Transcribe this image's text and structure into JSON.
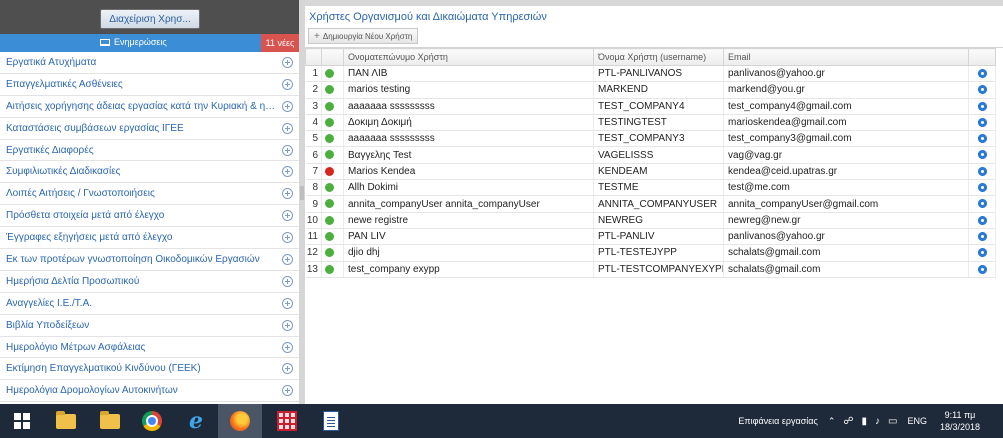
{
  "left": {
    "manage_button": "Διαχείριση Χρησ...",
    "notifications_label": "Ενημερώσεις",
    "notifications_count": "11 νέες",
    "menu": [
      "Εργατικά Ατυχήματα",
      "Επαγγελματικές Ασθένειες",
      "Αιτήσεις χορήγησης άδειας εργασίας κατά την Κυριακή & ημέ...",
      "Καταστάσεις συμβάσεων εργασίας ΙΓΕΕ",
      "Εργατικές Διαφορές",
      "Συμφιλιωτικές Διαδικασίες",
      "Λοιπές Αιτήσεις / Γνωστοποιήσεις",
      "Πρόσθετα στοιχεία μετά από έλεγχο",
      "Έγγραφες εξηγήσεις μετά από έλεγχο",
      "Εκ των προτέρων γνωστοποίηση Οικοδομικών Εργασιών",
      "Ημερήσια Δελτία Προσωπικού",
      "Αναγγελίες Ι.Ε./Τ.Α.",
      "Βιβλία Υποδείξεων",
      "Ημερολόγιο Μέτρων Ασφάλειας",
      "Εκτίμηση Επαγγελματικού Κινδύνου (ΓΕΕΚ)",
      "Ημερολόγια Δρομολογίων Αυτοκινήτων"
    ]
  },
  "right": {
    "title": "Χρήστες Οργανισμού και Δικαιώματα Υπηρεσιών",
    "create_button": "Δημιουργία Νέου Χρήστη",
    "columns": {
      "fullname": "Ονοματεπώνυμο Χρήστη",
      "username": "Όνομα Χρήστη (username)",
      "email": "Email"
    },
    "rows": [
      {
        "n": "1",
        "status": "#4caf3f",
        "name": "ΠΑΝ ΛΙΒ",
        "user": "PTL-PANLIVANOS",
        "email": "panlivanos@yahoo.gr"
      },
      {
        "n": "2",
        "status": "#4caf3f",
        "name": "marios testing",
        "user": "MARKEND",
        "email": "markend@you.gr"
      },
      {
        "n": "3",
        "status": "#4caf3f",
        "name": "aaaaaaa sssssssss",
        "user": "TEST_COMPANY4",
        "email": "test_company4@gmail.com"
      },
      {
        "n": "4",
        "status": "#4caf3f",
        "name": "Δοκιμη Δοκιμή",
        "user": "TESTINGTEST",
        "email": "marioskendea@gmail.com"
      },
      {
        "n": "5",
        "status": "#4caf3f",
        "name": "aaaaaaa sssssssss",
        "user": "TEST_COMPANY3",
        "email": "test_company3@gmail.com"
      },
      {
        "n": "6",
        "status": "#4caf3f",
        "name": "Βαγγελης Test",
        "user": "VAGELISSS",
        "email": "vag@vag.gr"
      },
      {
        "n": "7",
        "status": "#d9261c",
        "name": "Marios Kendea",
        "user": "KENDEAM",
        "email": "kendea@ceid.upatras.gr"
      },
      {
        "n": "8",
        "status": "#4caf3f",
        "name": "Allh Dokimi",
        "user": "TESTME",
        "email": "test@me.com"
      },
      {
        "n": "9",
        "status": "#4caf3f",
        "name": "annita_companyUser annita_companyUser",
        "user": "ANNITA_COMPANYUSER",
        "email": "annita_companyUser@gmail.com"
      },
      {
        "n": "10",
        "status": "#4caf3f",
        "name": "newe registre",
        "user": "NEWREG",
        "email": "newreg@new.gr"
      },
      {
        "n": "11",
        "status": "#4caf3f",
        "name": "PAN LIV",
        "user": "PTL-PANLIV",
        "email": "panlivanos@yahoo.gr"
      },
      {
        "n": "12",
        "status": "#4caf3f",
        "name": "djio dhj",
        "user": "PTL-TESTEJYPP",
        "email": "schalats@gmail.com"
      },
      {
        "n": "13",
        "status": "#4caf3f",
        "name": "test_company exypp",
        "user": "PTL-TESTCOMPANYEXYPP",
        "email": "schalats@gmail.com"
      }
    ]
  },
  "taskbar": {
    "desktop_label": "Επιφάνεια εργασίας",
    "language": "ENG",
    "time": "9:11 πμ",
    "date": "18/3/2018"
  }
}
